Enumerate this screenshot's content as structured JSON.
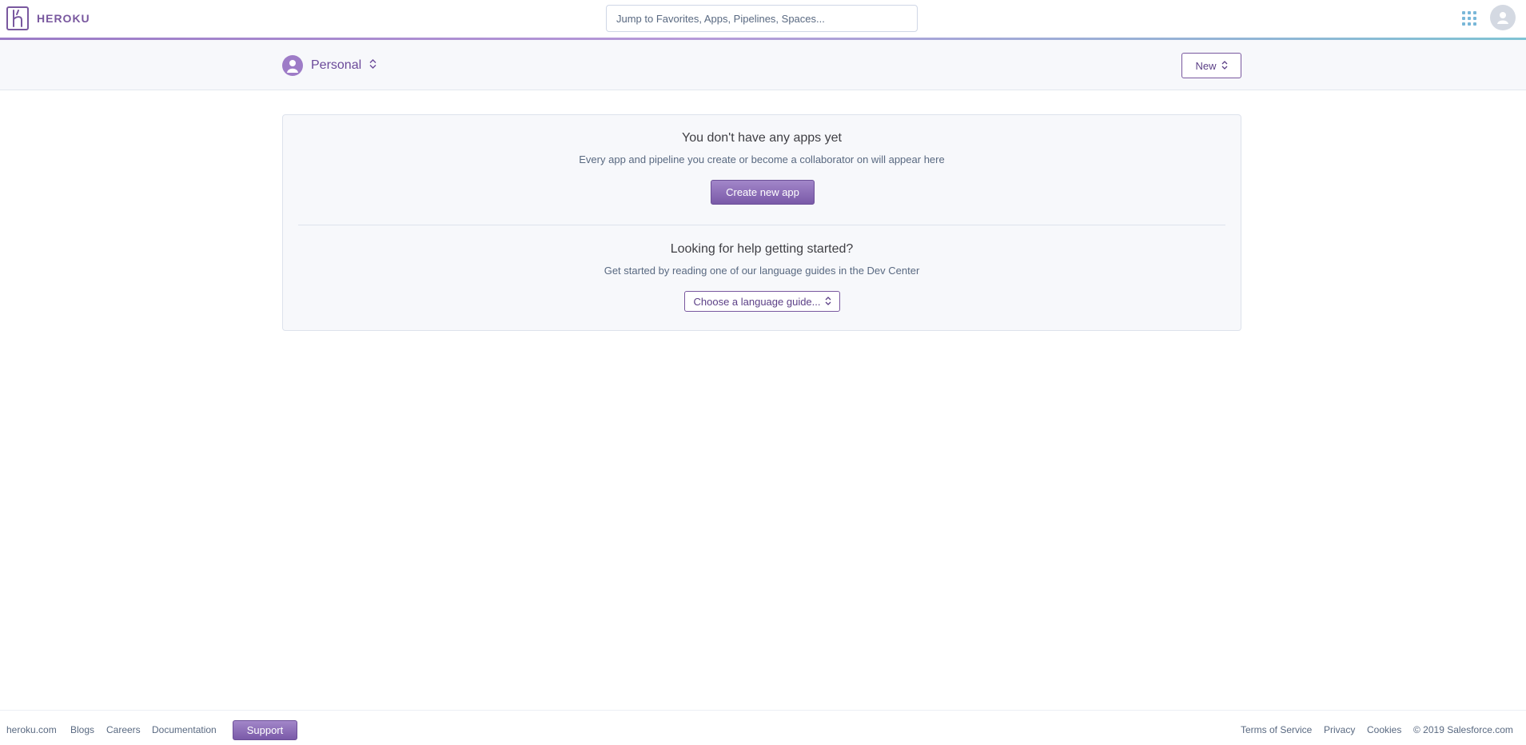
{
  "brand": {
    "name": "HEROKU",
    "accent": "#79589f"
  },
  "topbar": {
    "search_placeholder": "Jump to Favorites, Apps, Pipelines, Spaces...",
    "apps_icon": "apps-grid-icon",
    "avatar_icon": "user-avatar-icon"
  },
  "subheader": {
    "account_name": "Personal",
    "new_label": "New"
  },
  "empty_state": {
    "title": "You don't have any apps yet",
    "description": "Every app and pipeline you create or become a collaborator on will appear here",
    "create_label": "Create new app"
  },
  "help": {
    "title": "Looking for help getting started?",
    "description": "Get started by reading one of our language guides in the Dev Center",
    "select_label": "Choose a language guide..."
  },
  "footer": {
    "links": [
      "heroku.com",
      "Blogs",
      "Careers",
      "Documentation"
    ],
    "support_label": "Support",
    "right_links": [
      "Terms of Service",
      "Privacy",
      "Cookies"
    ],
    "copyright": "© 2019 Salesforce.com"
  }
}
